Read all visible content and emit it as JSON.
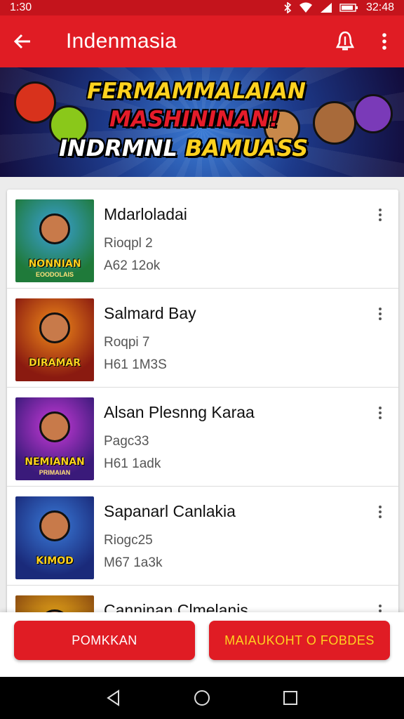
{
  "status_bar": {
    "time_left": "1:30",
    "time_right": "32:48",
    "icons": [
      "bluetooth-icon",
      "wifi-icon",
      "signal-icon",
      "battery-icon"
    ]
  },
  "app_bar": {
    "title": "Indenmasia",
    "icons": [
      "back-arrow-icon",
      "notification-bell-icon",
      "more-vert-icon"
    ]
  },
  "banner": {
    "line1": "FERMAMMALAIAN",
    "line2": "MASHININAN!",
    "line3_a": "INDRMNL",
    "line3_b": "BAMUASS"
  },
  "games": [
    {
      "name": "Mdarloladai",
      "meta1": "Rioqpl 2",
      "meta2": "A62 12ok",
      "thumb_caption": "NONNIAN",
      "thumb_sub": "EOODOLAIS",
      "thumb_colors": [
        "#1f7a3a",
        "#3aa0d8"
      ]
    },
    {
      "name": "Salmard Bay",
      "meta1": "Roqpi 7",
      "meta2": "H61 1M3S",
      "thumb_caption": "DIRAMAR",
      "thumb_sub": "",
      "thumb_colors": [
        "#8a1a10",
        "#f08a1a"
      ]
    },
    {
      "name": "Alsan Plesnng Karaa",
      "meta1": "Pagc33",
      "meta2": "H61 1adk",
      "thumb_caption": "NEMIANAN",
      "thumb_sub": "PRIMAIAN",
      "thumb_colors": [
        "#3a1a7a",
        "#c83ad8"
      ]
    },
    {
      "name": "Sapanarl Canlakia",
      "meta1": "Riogc25",
      "meta2": "M67 1a3k",
      "thumb_caption": "KIMOD",
      "thumb_sub": "",
      "thumb_colors": [
        "#1a2a7a",
        "#3a7ad8"
      ]
    },
    {
      "name": "Canninan Clmelanis",
      "meta1": "",
      "meta2": "",
      "thumb_caption": "",
      "thumb_sub": "",
      "thumb_colors": [
        "#8a4a10",
        "#f0b01a"
      ]
    }
  ],
  "buttons": {
    "primary": "POMKKAN",
    "secondary": "MAIAUKOHT O FOBDES"
  },
  "nav": [
    "back-triangle-icon",
    "home-circle-icon",
    "recents-square-icon"
  ]
}
